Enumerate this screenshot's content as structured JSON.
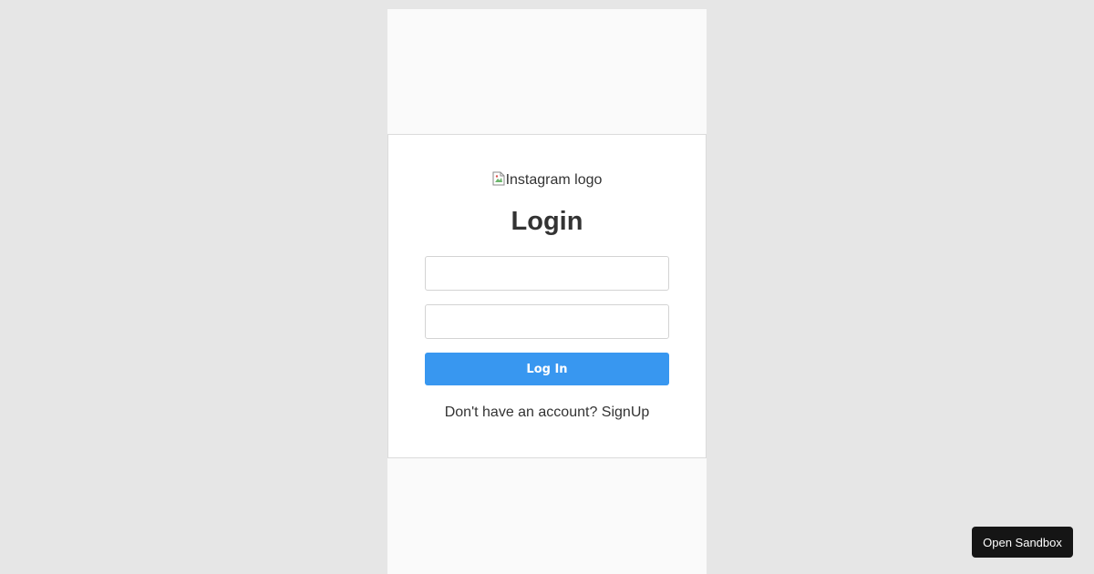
{
  "login": {
    "logo_alt": "Instagram logo",
    "title": "Login",
    "username": {
      "value": "",
      "placeholder": ""
    },
    "password": {
      "value": "",
      "placeholder": ""
    },
    "submit_label": "Log In",
    "signup_prompt": "Don't have an account?",
    "signup_link": "SignUp"
  },
  "sandbox": {
    "button_label": "Open Sandbox"
  },
  "colors": {
    "page_background": "#e6e6e6",
    "frame_background": "#fafafa",
    "card_background": "#ffffff",
    "accent": "#3897f0",
    "sandbox_button": "#151515",
    "text": "#333333"
  },
  "icons": {
    "logo": "broken-image-icon"
  }
}
